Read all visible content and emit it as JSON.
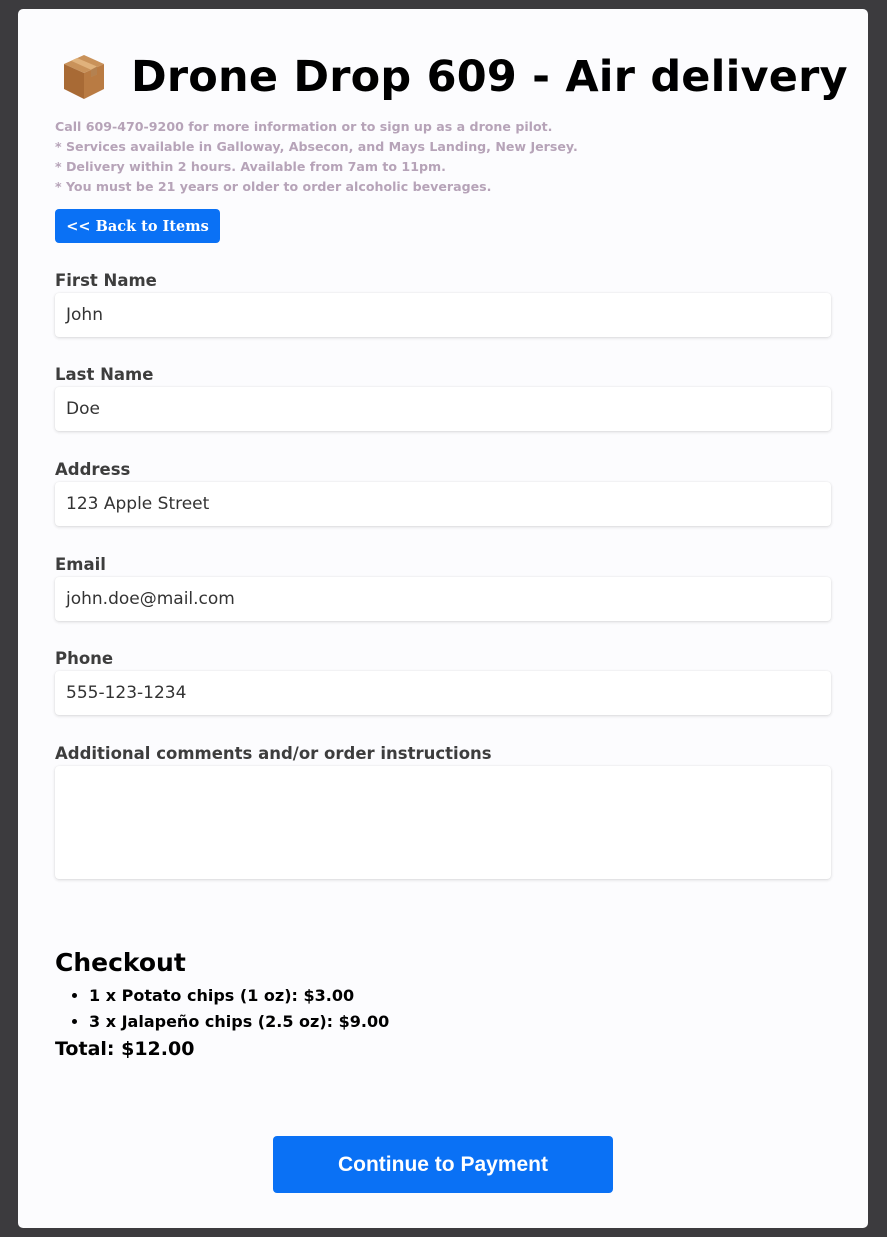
{
  "header": {
    "title": "Drone Drop 609 - Air delivery",
    "icon": "package-box-icon"
  },
  "notes": [
    "Call 609-470-9200 for more information or to sign up as a drone pilot.",
    "* Services available in Galloway, Absecon, and Mays Landing, New Jersey.",
    "* Delivery within 2 hours. Available from 7am to 11pm.",
    "* You must be 21 years or older to order alcoholic beverages."
  ],
  "back_button": {
    "label": "<< Back to Items"
  },
  "form": {
    "first_name": {
      "label": "First Name",
      "value": "John"
    },
    "last_name": {
      "label": "Last Name",
      "value": "Doe"
    },
    "address": {
      "label": "Address",
      "value": "123 Apple Street"
    },
    "email": {
      "label": "Email",
      "value": "john.doe@mail.com"
    },
    "phone": {
      "label": "Phone",
      "value": "555-123-1234"
    },
    "comments": {
      "label": "Additional comments and/or order instructions",
      "value": ""
    }
  },
  "checkout": {
    "title": "Checkout",
    "items": [
      "1 x Potato chips (1 oz):   $3.00",
      "3 x Jalapeño chips (2.5 oz):   $9.00"
    ],
    "total": "Total: $12.00"
  },
  "continue_button": {
    "label": "Continue to Payment"
  },
  "colors": {
    "accent": "#0a71f5",
    "background": "#3c3b3e",
    "card": "#fcfcfe",
    "notes_text": "#b6a3b8"
  }
}
